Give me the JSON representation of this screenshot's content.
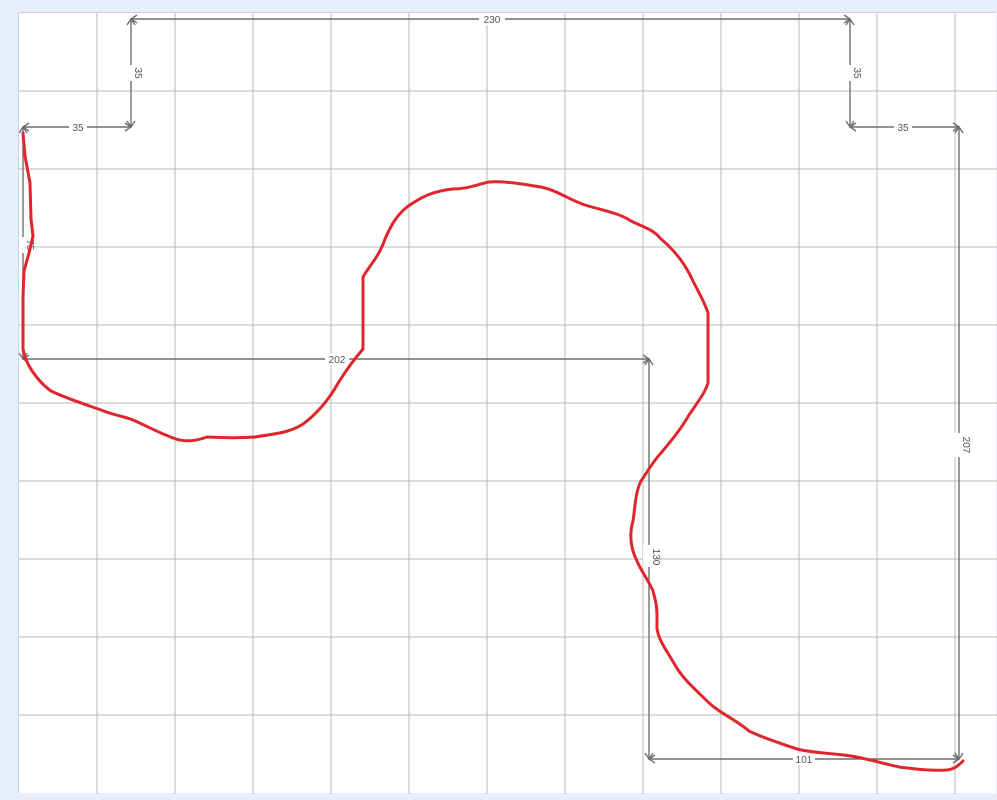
{
  "dimensions": {
    "top_width": "230",
    "left_step_height": "35",
    "left_step_width": "35",
    "right_step_height": "35",
    "right_step_width": "35",
    "left_height": "75",
    "middle_width": "202",
    "inner_height": "130",
    "right_height": "207",
    "bottom_width": "101"
  },
  "colors": {
    "sketch_stroke": "#e0262d",
    "dimension_line": "#6f6f6f",
    "grid_line": "#b9b9b9",
    "page_background": "#e8eefc"
  }
}
